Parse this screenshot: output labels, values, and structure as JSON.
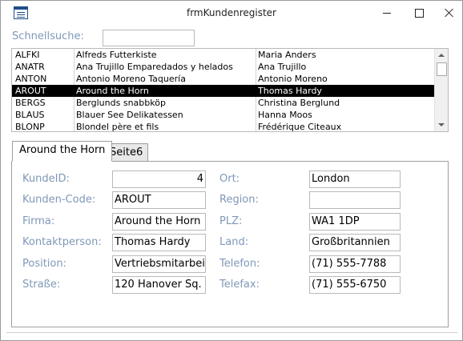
{
  "window": {
    "title": "frmKundenregister"
  },
  "quicksearch": {
    "label": "Schnellsuche:",
    "value": ""
  },
  "customers": [
    {
      "id": "ALFKI",
      "company": "Alfreds Futterkiste",
      "contact": "Maria Anders"
    },
    {
      "id": "ANATR",
      "company": "Ana Trujillo Emparedados y helados",
      "contact": "Ana Trujillo"
    },
    {
      "id": "ANTON",
      "company": "Antonio Moreno Taquería",
      "contact": "Antonio Moreno"
    },
    {
      "id": "AROUT",
      "company": "Around the Horn",
      "contact": "Thomas Hardy"
    },
    {
      "id": "BERGS",
      "company": "Berglunds snabbköp",
      "contact": "Christina Berglund"
    },
    {
      "id": "BLAUS",
      "company": "Blauer See Delikatessen",
      "contact": "Hanna Moos"
    },
    {
      "id": "BLONP",
      "company": "Blondel père et fils",
      "contact": "Frédérique Citeaux"
    }
  ],
  "selected_index": 3,
  "tabs": [
    {
      "label": "Around the Horn",
      "active": true
    },
    {
      "label": "Seite6",
      "active": false
    }
  ],
  "form": {
    "left": [
      {
        "label": "KundeID:",
        "value": "4"
      },
      {
        "label": "Kunden-Code:",
        "value": "AROUT"
      },
      {
        "label": "Firma:",
        "value": "Around the Horn"
      },
      {
        "label": "Kontaktperson:",
        "value": "Thomas Hardy"
      },
      {
        "label": "Position:",
        "value": "Vertriebsmitarbei"
      },
      {
        "label": "Straße:",
        "value": "120 Hanover Sq."
      }
    ],
    "right": [
      {
        "label": "Ort:",
        "value": "London"
      },
      {
        "label": "Region:",
        "value": ""
      },
      {
        "label": "PLZ:",
        "value": "WA1 1DP"
      },
      {
        "label": "Land:",
        "value": "Großbritannien"
      },
      {
        "label": "Telefon:",
        "value": "(71) 555-7788"
      },
      {
        "label": "Telefax:",
        "value": "(71) 555-6750"
      }
    ]
  },
  "colors": {
    "label": "#7f98b8",
    "selection": "#000000"
  }
}
